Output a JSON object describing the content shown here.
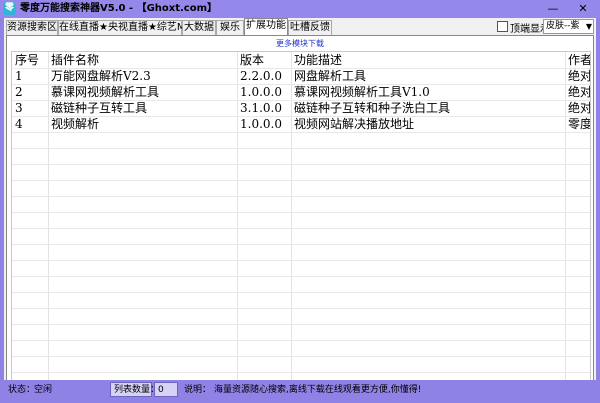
{
  "window": {
    "title": "零度万能搜索神器V5.0 - 【Ghoxt.com】",
    "minimize_glyph": "—",
    "close_glyph": "✕"
  },
  "tabs": [
    {
      "label": "资源搜索区",
      "active": false
    },
    {
      "label": "在线直播★央视直播★综艺MV",
      "active": false
    },
    {
      "label": "大数据",
      "active": false
    },
    {
      "label": "娱乐",
      "active": false
    },
    {
      "label": "扩展功能",
      "active": true
    },
    {
      "label": "吐槽反馈",
      "active": false
    }
  ],
  "options": {
    "top_most_label": "顶端显示",
    "top_most_checked": false,
    "skin_value": "皮肤--紫"
  },
  "panel": {
    "more_link": "更多模块下载"
  },
  "table": {
    "columns": [
      "序号",
      "插件名称",
      "版本",
      "功能描述",
      "作者"
    ],
    "rows": [
      [
        "1",
        "万能网盘解析V2.3",
        "2.2.0.0",
        "网盘解析工具",
        "绝对零度"
      ],
      [
        "2",
        "慕课网视频解析工具",
        "1.0.0.0",
        "慕课网视频解析工具V1.0",
        "绝对零度"
      ],
      [
        "3",
        "磁链种子互转工具",
        "3.1.0.0",
        "磁链种子互转和种子洗白工具",
        "绝对零度"
      ],
      [
        "4",
        "视频解析",
        "1.0.0.0",
        "视频网站解决播放地址",
        "零度团队"
      ]
    ]
  },
  "status": {
    "state_label": "状态：",
    "state_value": "空闲",
    "count_label": "列表数量：",
    "count_value": "0",
    "desc_label": "说明：",
    "desc_value": "海量资源随心搜索,离线下载在线观看更方便,你懂得!"
  },
  "colors": {
    "frame": "#8f82e6",
    "link": "#2233cc"
  }
}
